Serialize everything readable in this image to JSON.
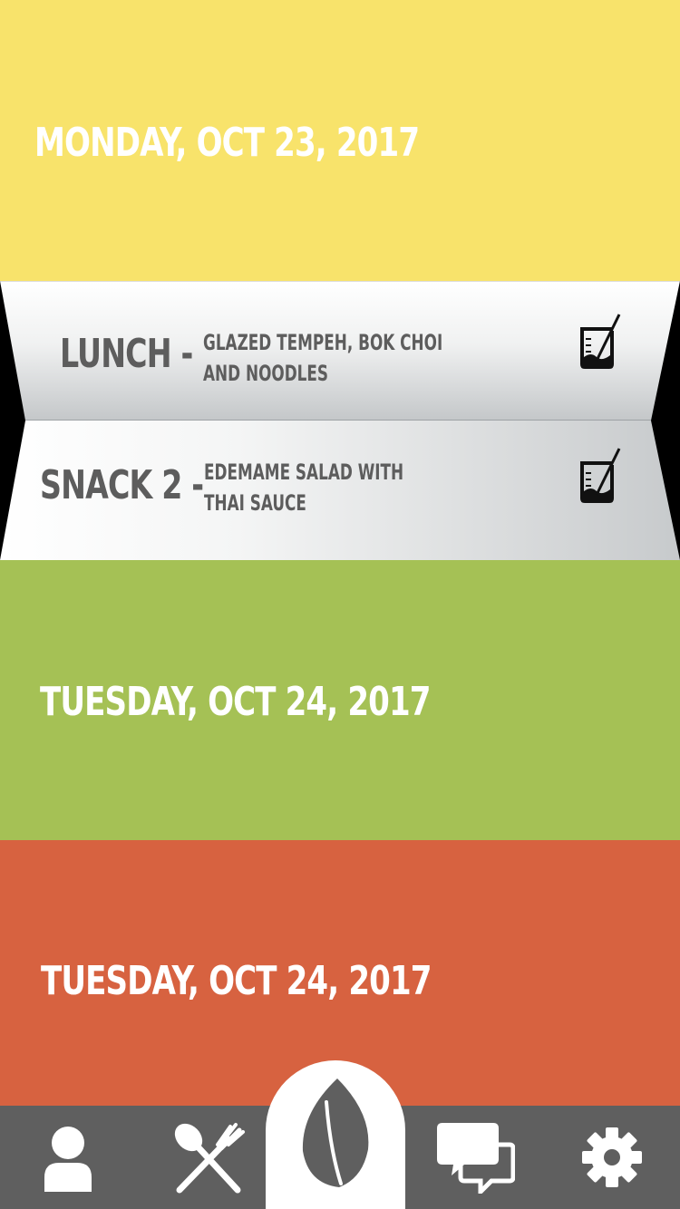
{
  "days": [
    {
      "title": "MONDAY, OCT 23, 2017",
      "color": "#f8e36b"
    },
    {
      "title": "TUESDAY, OCT 24, 2017",
      "color": "#a5c155"
    },
    {
      "title": "TUESDAY, OCT 24, 2017",
      "color": "#d76240"
    }
  ],
  "meals": [
    {
      "type": "LUNCH -",
      "description": "GLAZED TEMPEH, BOK CHOI AND NOODLES",
      "icon": "blender-icon"
    },
    {
      "type": "SNACK 2 -",
      "description": "EDEMAME SALAD WITH THAI SAUCE",
      "icon": "blender-icon"
    }
  ],
  "nav": {
    "items": [
      {
        "name": "profile",
        "icon": "person-icon"
      },
      {
        "name": "meals",
        "icon": "fork-spoon-icon"
      },
      {
        "name": "home",
        "icon": "leaf-icon"
      },
      {
        "name": "chat",
        "icon": "chat-bubbles-icon"
      },
      {
        "name": "settings",
        "icon": "gear-icon"
      }
    ],
    "bar_color": "#5f5f5f"
  }
}
